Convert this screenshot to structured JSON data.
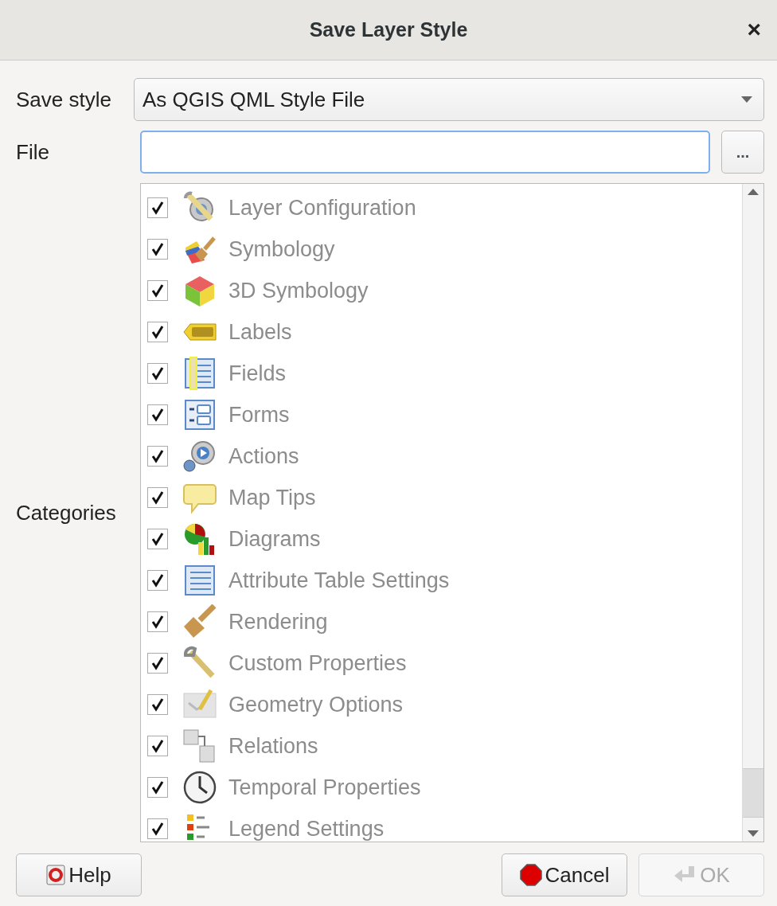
{
  "window": {
    "title": "Save Layer Style",
    "close": "×"
  },
  "save_style": {
    "label": "Save style",
    "value": "As QGIS QML Style File"
  },
  "file": {
    "label": "File",
    "browse": "..."
  },
  "categories": {
    "label": "Categories",
    "items": [
      {
        "label": "Layer Configuration",
        "checked": true,
        "disabled": true
      },
      {
        "label": "Symbology",
        "checked": true,
        "disabled": true
      },
      {
        "label": "3D Symbology",
        "checked": true,
        "disabled": true
      },
      {
        "label": "Labels",
        "checked": true,
        "disabled": true
      },
      {
        "label": "Fields",
        "checked": true,
        "disabled": true
      },
      {
        "label": "Forms",
        "checked": true,
        "disabled": true
      },
      {
        "label": "Actions",
        "checked": true,
        "disabled": true
      },
      {
        "label": "Map Tips",
        "checked": true,
        "disabled": true
      },
      {
        "label": "Diagrams",
        "checked": true,
        "disabled": true
      },
      {
        "label": "Attribute Table Settings",
        "checked": true,
        "disabled": true
      },
      {
        "label": "Rendering",
        "checked": true,
        "disabled": true
      },
      {
        "label": "Custom Properties",
        "checked": true,
        "disabled": true
      },
      {
        "label": "Geometry Options",
        "checked": true,
        "disabled": true
      },
      {
        "label": "Relations",
        "checked": true,
        "disabled": true
      },
      {
        "label": "Temporal Properties",
        "checked": true,
        "disabled": true
      },
      {
        "label": "Legend Settings",
        "checked": true,
        "disabled": true
      }
    ]
  },
  "buttons": [
    {
      "label": "Help",
      "kind": "help",
      "disabled": false
    },
    {
      "label": "Cancel",
      "kind": "cancel",
      "disabled": false
    },
    {
      "label": "OK",
      "kind": "ok",
      "disabled": true
    }
  ]
}
